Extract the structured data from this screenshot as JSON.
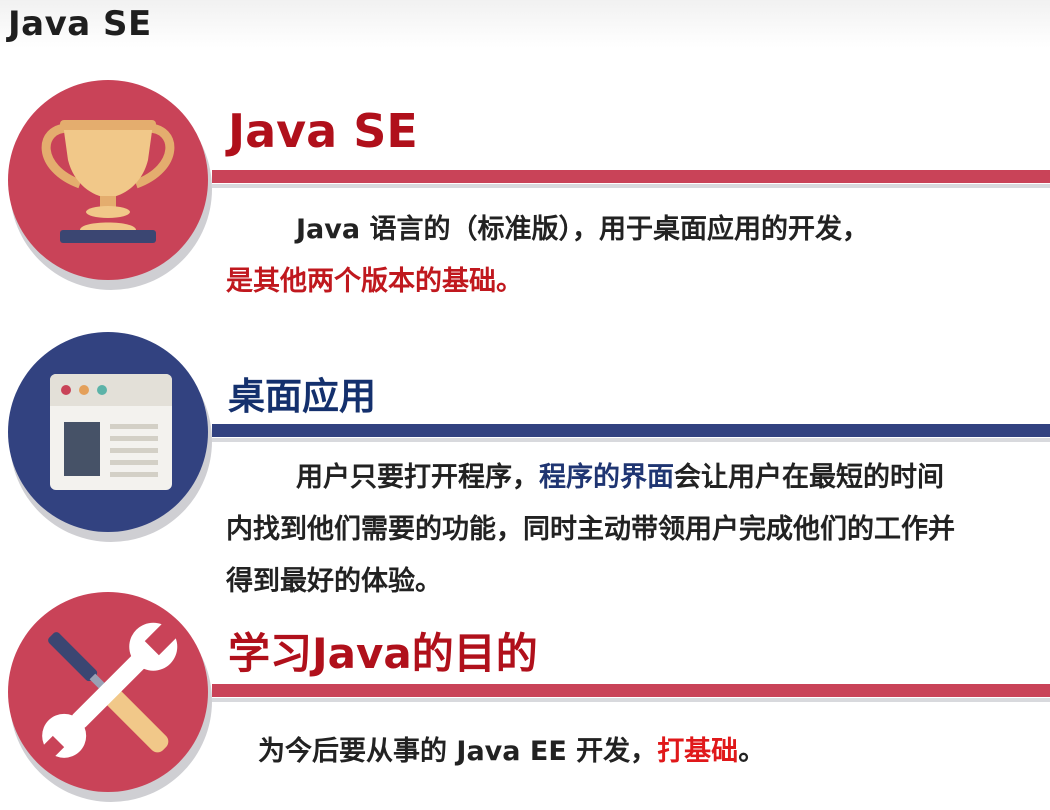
{
  "page": {
    "title": "Java SE"
  },
  "colors": {
    "crimson": "#c94358",
    "navy": "#324280",
    "heading_red": "#b0101b",
    "heading_navy": "#14306d",
    "highlight_red": "#c0181e",
    "highlight_navy": "#1f3572"
  },
  "sections": [
    {
      "icon": "trophy-icon",
      "heading": "Java SE",
      "text_parts": [
        "Java 语言的（标准版），用于桌面应用的开发，",
        "是其他两个版本的基础。"
      ]
    },
    {
      "icon": "browser-window-icon",
      "heading": "桌面应用",
      "text_parts": [
        "用户只要打开程序，",
        "程序的界面",
        "会让用户在最短的时间",
        "内找到他们需要的功能，同时主动带领用户完成他们的工作并",
        "得到最好的体验。"
      ]
    },
    {
      "icon": "tools-icon",
      "heading": "学习Java的目的",
      "text_parts": [
        "为今后要从事的 Java EE 开发，",
        "打基础",
        "。"
      ]
    }
  ]
}
